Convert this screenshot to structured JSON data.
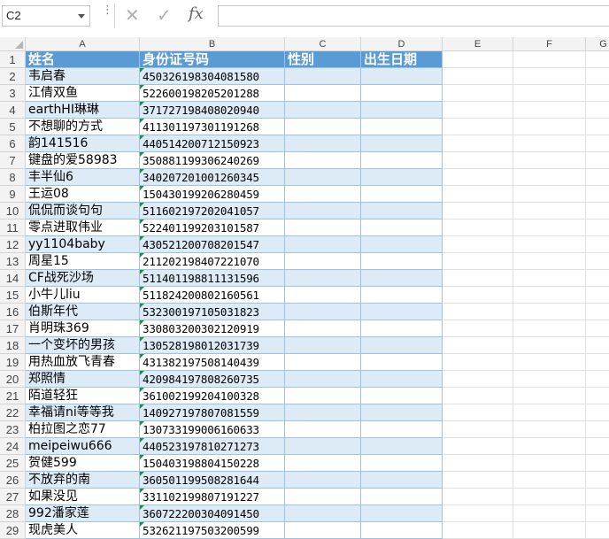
{
  "name_box": "C2",
  "formula_value": "",
  "columns": [
    "A",
    "B",
    "C",
    "D",
    "E",
    "F",
    "G"
  ],
  "header_row": {
    "name": "姓名",
    "id": "身份证号码",
    "gender": "性别",
    "birth": "出生日期"
  },
  "rows": [
    {
      "num": "2",
      "name": "韦启春",
      "id": "450326198304081580"
    },
    {
      "num": "3",
      "name": "江倩双鱼",
      "id": "522600198205201288"
    },
    {
      "num": "4",
      "name": "earthHI琳琳",
      "id": "371727198408020940"
    },
    {
      "num": "5",
      "name": "不想聊的方式",
      "id": "411301197301191268"
    },
    {
      "num": "6",
      "name": "韵141516",
      "id": "440514200712150923"
    },
    {
      "num": "7",
      "name": "键盘的爱58983",
      "id": "350881199306240269"
    },
    {
      "num": "8",
      "name": "丰半仙6",
      "id": "340207201001260345"
    },
    {
      "num": "9",
      "name": "王运08",
      "id": "150430199206280459"
    },
    {
      "num": "10",
      "name": "侃侃而谈句句",
      "id": "511602197202041057"
    },
    {
      "num": "11",
      "name": "零点进取伟业",
      "id": "522401199203101587"
    },
    {
      "num": "12",
      "name": "yy1104baby",
      "id": "430521200708201547"
    },
    {
      "num": "13",
      "name": "周星15",
      "id": "211202198407221070"
    },
    {
      "num": "14",
      "name": "CF战死沙场",
      "id": "511401198811131596"
    },
    {
      "num": "15",
      "name": "小牛儿liu",
      "id": "511824200802160561"
    },
    {
      "num": "16",
      "name": "伯斯年代",
      "id": "532300197105031823"
    },
    {
      "num": "17",
      "name": "肖明珠369",
      "id": "330803200302120919"
    },
    {
      "num": "18",
      "name": "一个变坏的男孩",
      "id": "130528198012031739"
    },
    {
      "num": "19",
      "name": "用热血放飞青春",
      "id": "431382197508140439"
    },
    {
      "num": "20",
      "name": "郑照情",
      "id": "420984197808260735"
    },
    {
      "num": "21",
      "name": "陌道轻狂",
      "id": "361002199204100328"
    },
    {
      "num": "22",
      "name": "幸福请ni等等我",
      "id": "140927197807081559"
    },
    {
      "num": "23",
      "name": "柏拉图之恋77",
      "id": "130733199006160633"
    },
    {
      "num": "24",
      "name": "meipeiwu666",
      "id": "440523197810271273"
    },
    {
      "num": "25",
      "name": "贺健599",
      "id": "150403198804150228"
    },
    {
      "num": "26",
      "name": "不放弃的南",
      "id": "360501199508281644"
    },
    {
      "num": "27",
      "name": "如果没见",
      "id": "331102199807191227"
    },
    {
      "num": "28",
      "name": "992潘家莲",
      "id": "360722200304091450"
    },
    {
      "num": "29",
      "name": "现虎美人",
      "id": "532621197503200599"
    }
  ],
  "row1_num": "1",
  "icons": {
    "cancel": "✕",
    "confirm": "✓",
    "function": "fx",
    "more": "⋮"
  }
}
